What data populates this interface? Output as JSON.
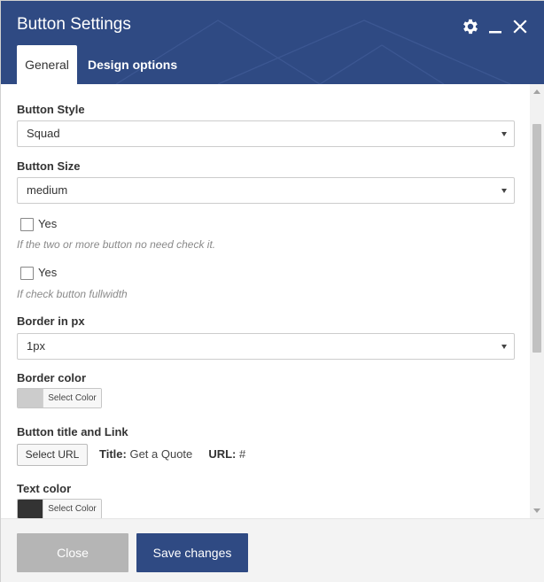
{
  "window": {
    "title": "Button Settings",
    "icons": {
      "settings": "gear-icon",
      "minimize": "minimize-icon",
      "close": "close-icon"
    }
  },
  "tabs": [
    {
      "label": "General",
      "active": true
    },
    {
      "label": "Design options",
      "active": false
    }
  ],
  "form": {
    "button_style": {
      "label": "Button Style",
      "value": "Squad"
    },
    "button_size": {
      "label": "Button Size",
      "value": "medium"
    },
    "inline_option": {
      "label": "Yes",
      "checked": false,
      "help": "If the two or more button no need check it."
    },
    "fullwidth_option": {
      "label": "Yes",
      "checked": false,
      "help": "If check button fullwidth"
    },
    "border_px": {
      "label": "Border in px",
      "value": "1px"
    },
    "border_color": {
      "label": "Border color",
      "picker_label": "Select Color",
      "color": "#cccccc"
    },
    "title_link": {
      "label": "Button title and Link",
      "button_label": "Select URL",
      "title_key": "Title:",
      "title_value": "Get a Quote",
      "url_key": "URL:",
      "url_value": "#"
    },
    "text_color": {
      "label": "Text color",
      "picker_label": "Select Color",
      "color": "#333333"
    }
  },
  "footer": {
    "close_label": "Close",
    "save_label": "Save changes"
  },
  "colors": {
    "header": "#2f4a83",
    "primary_button": "#2f4a83",
    "close_button": "#b5b5b5"
  }
}
